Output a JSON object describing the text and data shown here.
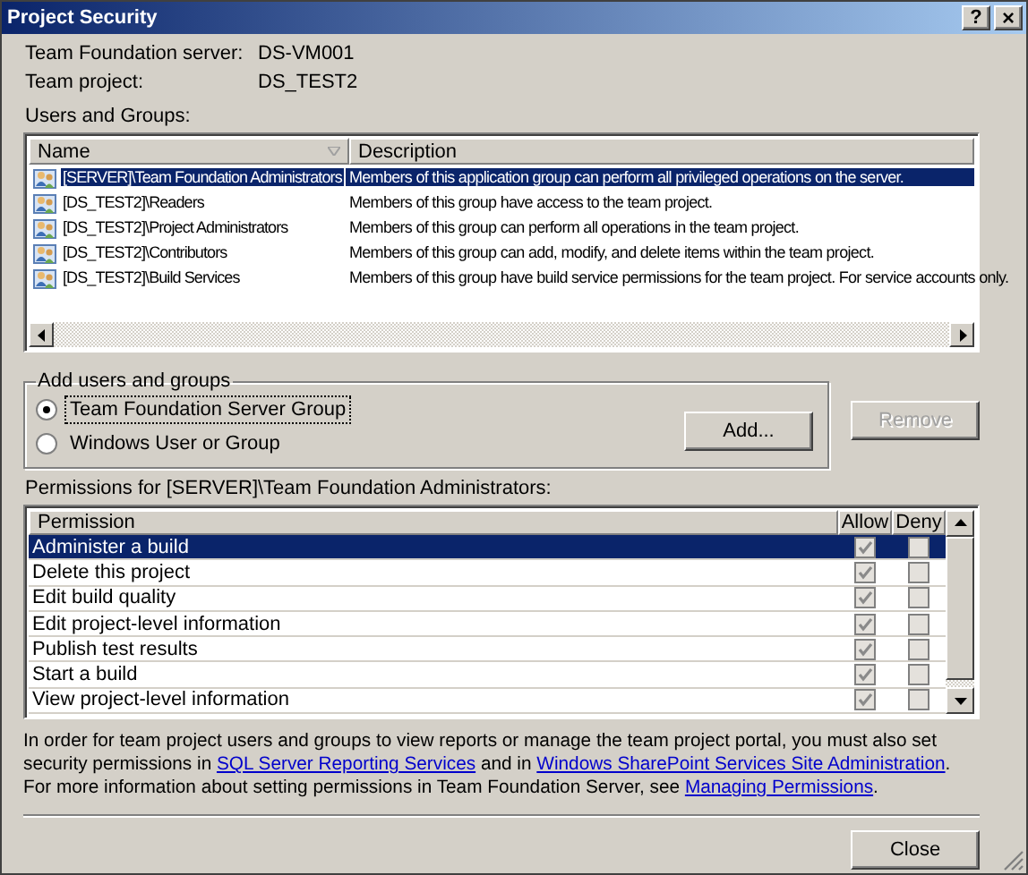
{
  "window": {
    "title": "Project Security",
    "controls": [
      {
        "kind": "help",
        "label": "?"
      },
      {
        "kind": "close",
        "label": "×"
      }
    ]
  },
  "info": [
    {
      "label": "Team Foundation server:",
      "value": "DS-VM001"
    },
    {
      "label": "Team project:",
      "value": "DS_TEST2"
    }
  ],
  "users_and_groups": {
    "label": "Users and Groups:",
    "columns": [
      "Name",
      "Description"
    ],
    "rows": [
      {
        "name": "[SERVER]\\Team Foundation Administrators",
        "description": "Members of this application group can perform all privileged operations on the server.",
        "selected": true
      },
      {
        "name": "[DS_TEST2]\\Readers",
        "description": "Members of this group have access to the team project.",
        "selected": false
      },
      {
        "name": "[DS_TEST2]\\Project Administrators",
        "description": "Members of this group can perform all operations in the team project.",
        "selected": false
      },
      {
        "name": "[DS_TEST2]\\Contributors",
        "description": "Members of this group can add, modify, and delete items within the team project.",
        "selected": false
      },
      {
        "name": "[DS_TEST2]\\Build Services",
        "description": "Members of this group have build service permissions for the team project. For service accounts only.",
        "selected": false
      }
    ]
  },
  "add_users_and_groups": {
    "title": "Add users and groups",
    "options": [
      {
        "label": "Team Foundation Server Group",
        "selected": true,
        "focused": true
      },
      {
        "label": "Windows User or Group",
        "selected": false,
        "focused": false
      }
    ],
    "buttons": [
      {
        "label": "Add...",
        "disabled": false
      },
      {
        "label": "Remove",
        "disabled": true
      }
    ]
  },
  "permissions": {
    "label": "Permissions for [SERVER]\\Team Foundation Administrators:",
    "columns": [
      "Permission",
      "Allow",
      "Deny"
    ],
    "inherited": true,
    "rows": [
      {
        "name": "Administer a build",
        "allow": true,
        "deny": false,
        "selected": true
      },
      {
        "name": "Delete this project",
        "allow": true,
        "deny": false,
        "selected": false
      },
      {
        "name": "Edit build quality",
        "allow": true,
        "deny": false,
        "selected": false
      },
      {
        "name": "Edit project-level information",
        "allow": true,
        "deny": false,
        "selected": false
      },
      {
        "name": "Publish test results",
        "allow": true,
        "deny": false,
        "selected": false
      },
      {
        "name": "Start a build",
        "allow": true,
        "deny": false,
        "selected": false
      },
      {
        "name": "View project-level information",
        "allow": true,
        "deny": false,
        "selected": false
      }
    ]
  },
  "help_text": [
    {
      "kind": "text",
      "text": "In order for team project users and groups to view reports or manage the team project portal, you must also set security permissions in "
    },
    {
      "kind": "link",
      "text": "SQL Server Reporting Services"
    },
    {
      "kind": "text",
      "text": " and in "
    },
    {
      "kind": "link",
      "text": "Windows SharePoint Services Site Administration"
    },
    {
      "kind": "text",
      "text": ". For more information about setting permissions in Team Foundation Server, see "
    },
    {
      "kind": "link",
      "text": "Managing Permissions"
    },
    {
      "kind": "text",
      "text": "."
    }
  ],
  "footer": {
    "buttons": [
      {
        "label": "Close"
      }
    ]
  }
}
